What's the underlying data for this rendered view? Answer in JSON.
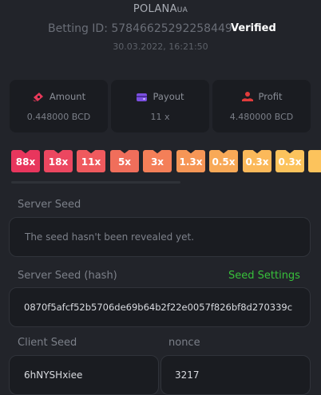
{
  "header": {
    "username": "POLANA",
    "username_sup": "UA",
    "betting_id": "Betting ID: 57846625292258449",
    "verified": "Verified",
    "datetime": "30.03.2022, 16:21:50"
  },
  "stats": [
    {
      "label": "Amount",
      "value": "0.448000 BCD",
      "icon": "money-icon",
      "color": "#e8395a"
    },
    {
      "label": "Payout",
      "value": "11 x",
      "icon": "wallet-icon",
      "color": "#7b4fe0"
    },
    {
      "label": "Profit",
      "value": "4.480000 BCD",
      "icon": "profit-icon",
      "color": "#e03c3c"
    }
  ],
  "multipliers": [
    {
      "label": "88x",
      "color": "#e8365d"
    },
    {
      "label": "18x",
      "color": "#ec4760"
    },
    {
      "label": "11x",
      "color": "#ef5a5e"
    },
    {
      "label": "5x",
      "color": "#f06e5b"
    },
    {
      "label": "3x",
      "color": "#f47f58"
    },
    {
      "label": "1.3x",
      "color": "#f69656"
    },
    {
      "label": "0.5x",
      "color": "#f8a957"
    },
    {
      "label": "0.3x",
      "color": "#fbb95a"
    },
    {
      "label": "0.3x",
      "color": "#fcc35c"
    }
  ],
  "server_seed": {
    "label": "Server Seed",
    "value": "The seed hasn't been revealed yet."
  },
  "server_seed_hash": {
    "label": "Server Seed (hash)",
    "link": "Seed Settings",
    "value": "0870f5afcf52b5706de69b64b2f22e0057f826bf8d270339c"
  },
  "client_seed": {
    "label": "Client Seed",
    "value": "6hNYSHxiee"
  },
  "nonce": {
    "label": "nonce",
    "value": "3217"
  }
}
